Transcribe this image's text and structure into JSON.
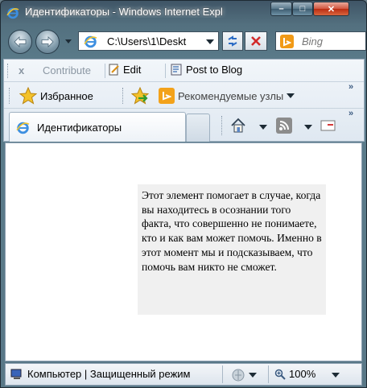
{
  "window": {
    "title": "Идентификаторы - Windows Internet Expl",
    "min_glyph": "–",
    "max_glyph": "□",
    "close_glyph": "✕"
  },
  "address": {
    "url": "C:\\Users\\1\\Deskt",
    "search_placeholder": "Bing"
  },
  "toolbar": {
    "close_label": "x",
    "contribute_label": "Contribute",
    "edit_label": "Edit",
    "post_label": "Post to Blog"
  },
  "favorites_bar": {
    "favorites_label": "Избранное",
    "suggested_label": "Рекомендуемые узлы"
  },
  "tabs": [
    {
      "label": "Идентификаторы"
    }
  ],
  "content": {
    "text": "Этот элемент помогает в случае, когда вы находитесь в осознании того факта, что совершенно не понимаете, кто и как вам может помочь. Именно в этот момент мы и подсказываем, что помочь вам никто не сможет."
  },
  "status": {
    "zone_text": "Компьютер | Защищенный режим",
    "zoom": "100%"
  },
  "colors": {
    "frame": "#53707f",
    "toolbar_bg": "#e8eef5",
    "content_box": "#f0f0f0",
    "close_button": "#c8442a"
  }
}
